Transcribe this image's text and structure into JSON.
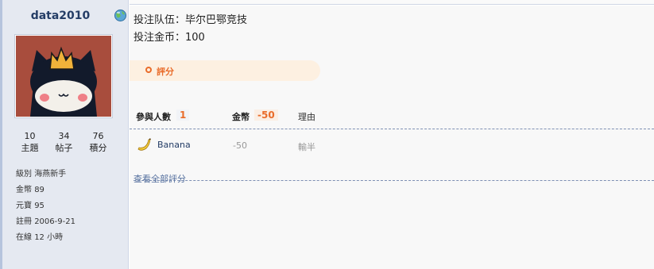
{
  "user": {
    "name": "data2010",
    "stats": [
      {
        "value": "10",
        "label": "主題"
      },
      {
        "value": "34",
        "label": "帖子"
      },
      {
        "value": "76",
        "label": "積分"
      }
    ],
    "profile": [
      {
        "key": "級別",
        "value": "海燕新手"
      },
      {
        "key": "金幣",
        "value": "89"
      },
      {
        "key": "元寶",
        "value": "95"
      },
      {
        "key": "註冊",
        "value": "2006-9-21"
      },
      {
        "key": "在線",
        "value": "12 小時"
      }
    ]
  },
  "post": {
    "bet_team_label": "投注队伍：",
    "bet_team": "毕尔巴鄂竞技",
    "bet_coins_label": "投注金币：",
    "bet_coins": "100"
  },
  "rating": {
    "section_title": "評分",
    "participants_label": "參與人數",
    "participants_count": "1",
    "coin_label": "金幣",
    "coin_total": "-50",
    "reason_label": "理由",
    "rows": [
      {
        "user": "Banana",
        "coin": "-50",
        "reason": "輸半"
      }
    ],
    "view_all": "查看全部評分"
  },
  "colors": {
    "accent": "#e96c2a",
    "sidebar_bg": "#e5e9f1",
    "link": "#243d66",
    "pill_bg": "#fdf0e1"
  },
  "icons": [
    "globe-icon",
    "avatar",
    "circle-icon",
    "banana-icon"
  ]
}
